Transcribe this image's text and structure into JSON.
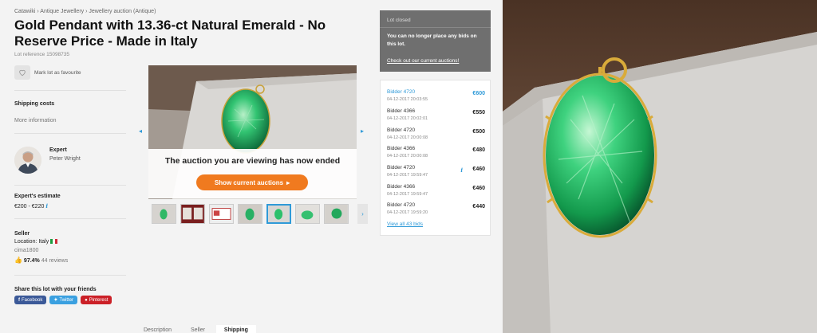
{
  "breadcrumb": "Catawiki › Antique Jewellery › Jewellery auction (Antique)",
  "title": "Gold Pendant with 13.36-ct Natural Emerald - No Reserve Price - Made in Italy",
  "lot_reference": "Lot reference 15098735",
  "favourite_label": "Mark lot as favourite",
  "shipping": {
    "heading": "Shipping costs",
    "link": "More information"
  },
  "expert": {
    "heading": "Expert",
    "name": "Peter Wright"
  },
  "estimate": {
    "heading": "Expert's estimate",
    "value": "€200 - €220",
    "info": "i"
  },
  "seller": {
    "heading": "Seller",
    "location": "Location: Italy",
    "username": "cima1800",
    "rating": "97.4%",
    "reviews": "44 reviews"
  },
  "share": {
    "heading": "Share this lot with your friends",
    "facebook": "Facebook",
    "twitter": "Twitter",
    "pinterest": "Pinterest"
  },
  "gallery": {
    "ended_message": "The auction you are viewing has now ended",
    "show_button": "Show current auctions",
    "prev_arrow": "◂",
    "next_arrow": "▸",
    "thumb_next": "›"
  },
  "lot_closed": {
    "title": "Lot closed",
    "message": "You can no longer place any bids on this lot.",
    "link": "Check out our current auctions!"
  },
  "bids": [
    {
      "bidder": "Bidder 4720",
      "time": "04-12-2017 20:03:55",
      "amount": "€600"
    },
    {
      "bidder": "Bidder 4366",
      "time": "04-12-2017 20:02:01",
      "amount": "€550"
    },
    {
      "bidder": "Bidder 4720",
      "time": "04-12-2017 20:00:08",
      "amount": "€500"
    },
    {
      "bidder": "Bidder 4366",
      "time": "04-12-2017 20:00:08",
      "amount": "€480"
    },
    {
      "bidder": "Bidder 4720",
      "time": "04-12-2017 19:59:47",
      "amount": "€460",
      "mark": "i"
    },
    {
      "bidder": "Bidder 4366",
      "time": "04-12-2017 19:59:47",
      "amount": "€460"
    },
    {
      "bidder": "Bidder 4720",
      "time": "04-12-2017 19:59:20",
      "amount": "€440"
    }
  ],
  "view_all_bids": "View all 43 bids",
  "tabs": [
    "Description",
    "Seller",
    "Shipping"
  ],
  "colors": {
    "accent": "#2f9ad8",
    "orange": "#f07a1f",
    "emerald": "#1fa85a",
    "closed_bg": "#6f6f6f"
  }
}
